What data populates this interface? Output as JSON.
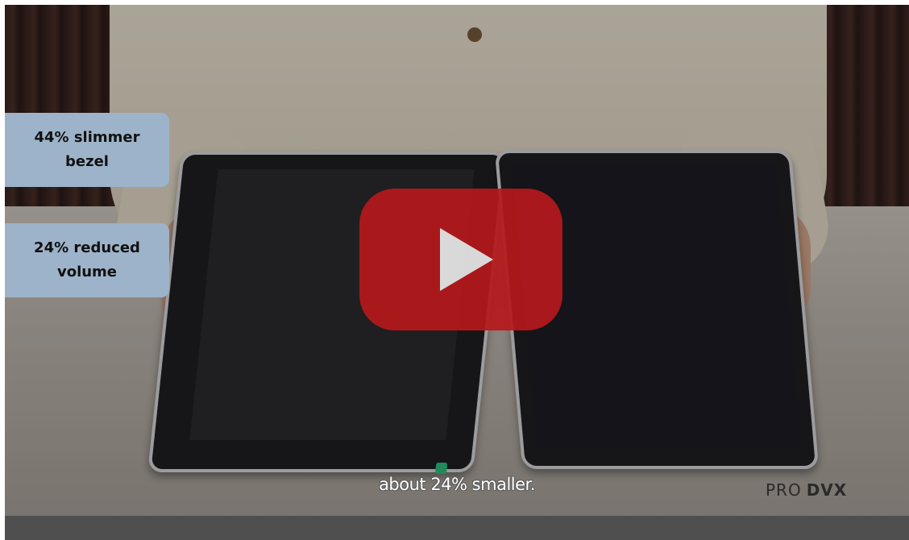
{
  "video": {
    "callouts": [
      {
        "text": "44% slimmer bezel"
      },
      {
        "text": "24% reduced volume"
      }
    ],
    "subtitle": "about 24% smaller.",
    "logo": {
      "pro": "PRO",
      "dvx": "DVX"
    },
    "play_button": {
      "icon": "play-icon"
    },
    "colors": {
      "play_button_red": "#b5191c",
      "callout_bg": "#9db3c9",
      "bottom_bar": "#4f4f4f",
      "led": "#2fbf7f"
    }
  }
}
